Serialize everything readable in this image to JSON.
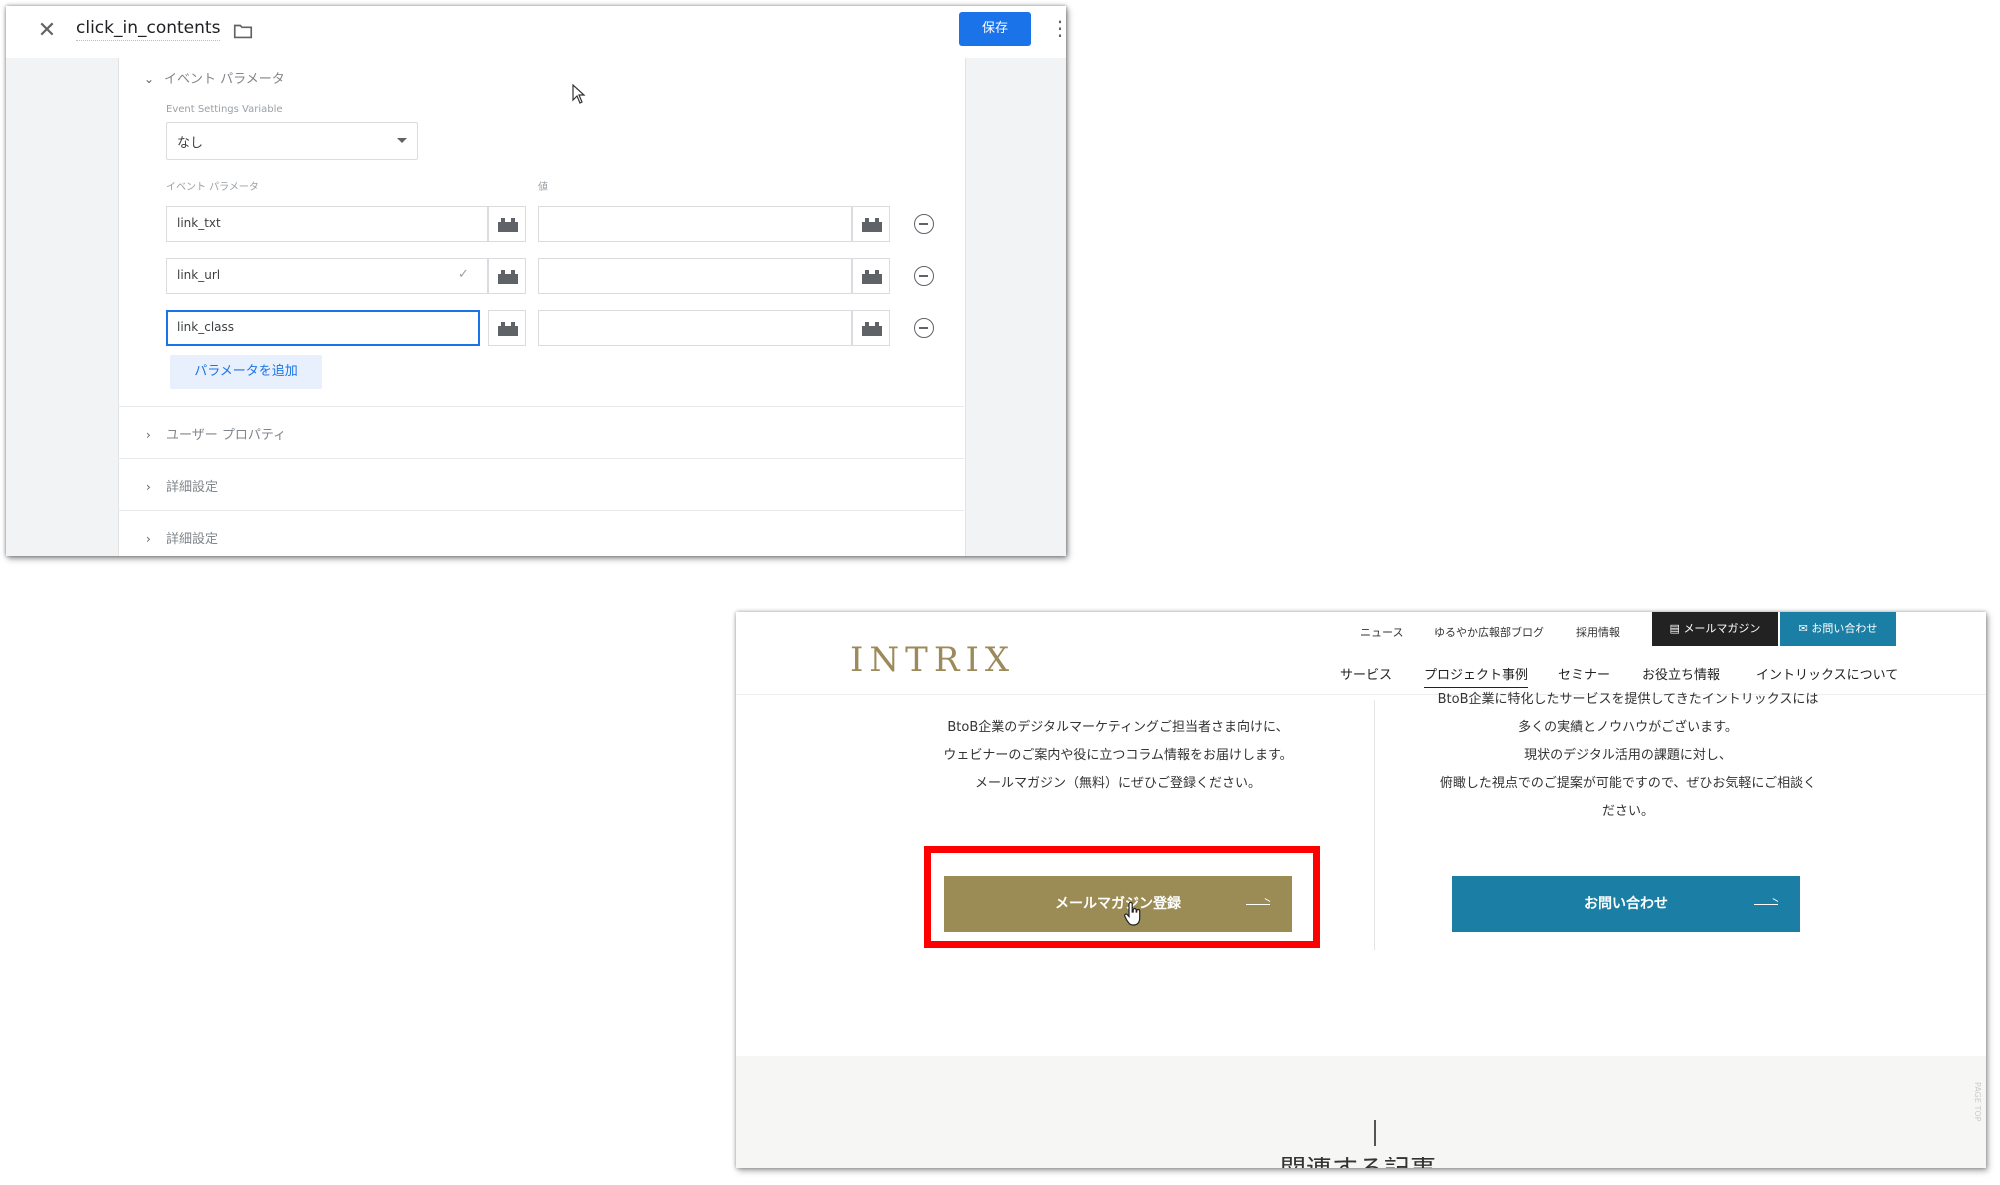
{
  "gtm": {
    "tag_name": "click_in_contents",
    "save_label": "保存",
    "sections": {
      "event_params_title": "イベント パラメータ",
      "user_props_title": "ユーザー プロパティ",
      "advanced_title_1": "詳細設定",
      "advanced_title_2": "詳細設定"
    },
    "event_settings": {
      "label": "Event Settings Variable",
      "selected": "なし"
    },
    "param_columns": {
      "name_header": "イベント パラメータ",
      "value_header": "値"
    },
    "params": [
      {
        "name": "link_txt",
        "value": ""
      },
      {
        "name": "link_url",
        "value": ""
      },
      {
        "name": "link_class",
        "value": ""
      }
    ],
    "add_param_label": "パラメータを追加"
  },
  "site": {
    "logo": "INTRIX",
    "utility_links": [
      "ニュース",
      "ゆるやか広報部ブログ",
      "採用情報"
    ],
    "mail_magazine_label": "メールマガジン",
    "contact_label": "お問い合わせ",
    "nav": [
      "サービス",
      "プロジェクト事例",
      "セミナー",
      "お役立ち情報",
      "イントリックスについて"
    ],
    "left_text": [
      "BtoB企業のデジタルマーケティングご担当者さま向けに、",
      "ウェビナーのご案内や役に立つコラム情報をお届けします。",
      "メールマガジン（無料）にぜひご登録ください。"
    ],
    "right_text": [
      "BtoB企業に特化したサービスを提供してきたイントリックスには",
      "多くの実績とノウハウがございます。",
      "現状のデジタル活用の課題に対し、",
      "俯瞰した視点でのご提案が可能ですので、ぜひお気軽にご相談く",
      "ださい。"
    ],
    "mag_button_label": "メールマガジン登録",
    "contact_button_label": "お問い合わせ",
    "cutoff_heading": "関連する記事"
  },
  "colors": {
    "gtm_blue": "#1a73e8",
    "intrix_gold": "#9b8c55",
    "intrix_teal": "#1b7fa5",
    "highlight_red": "#ff0000"
  }
}
